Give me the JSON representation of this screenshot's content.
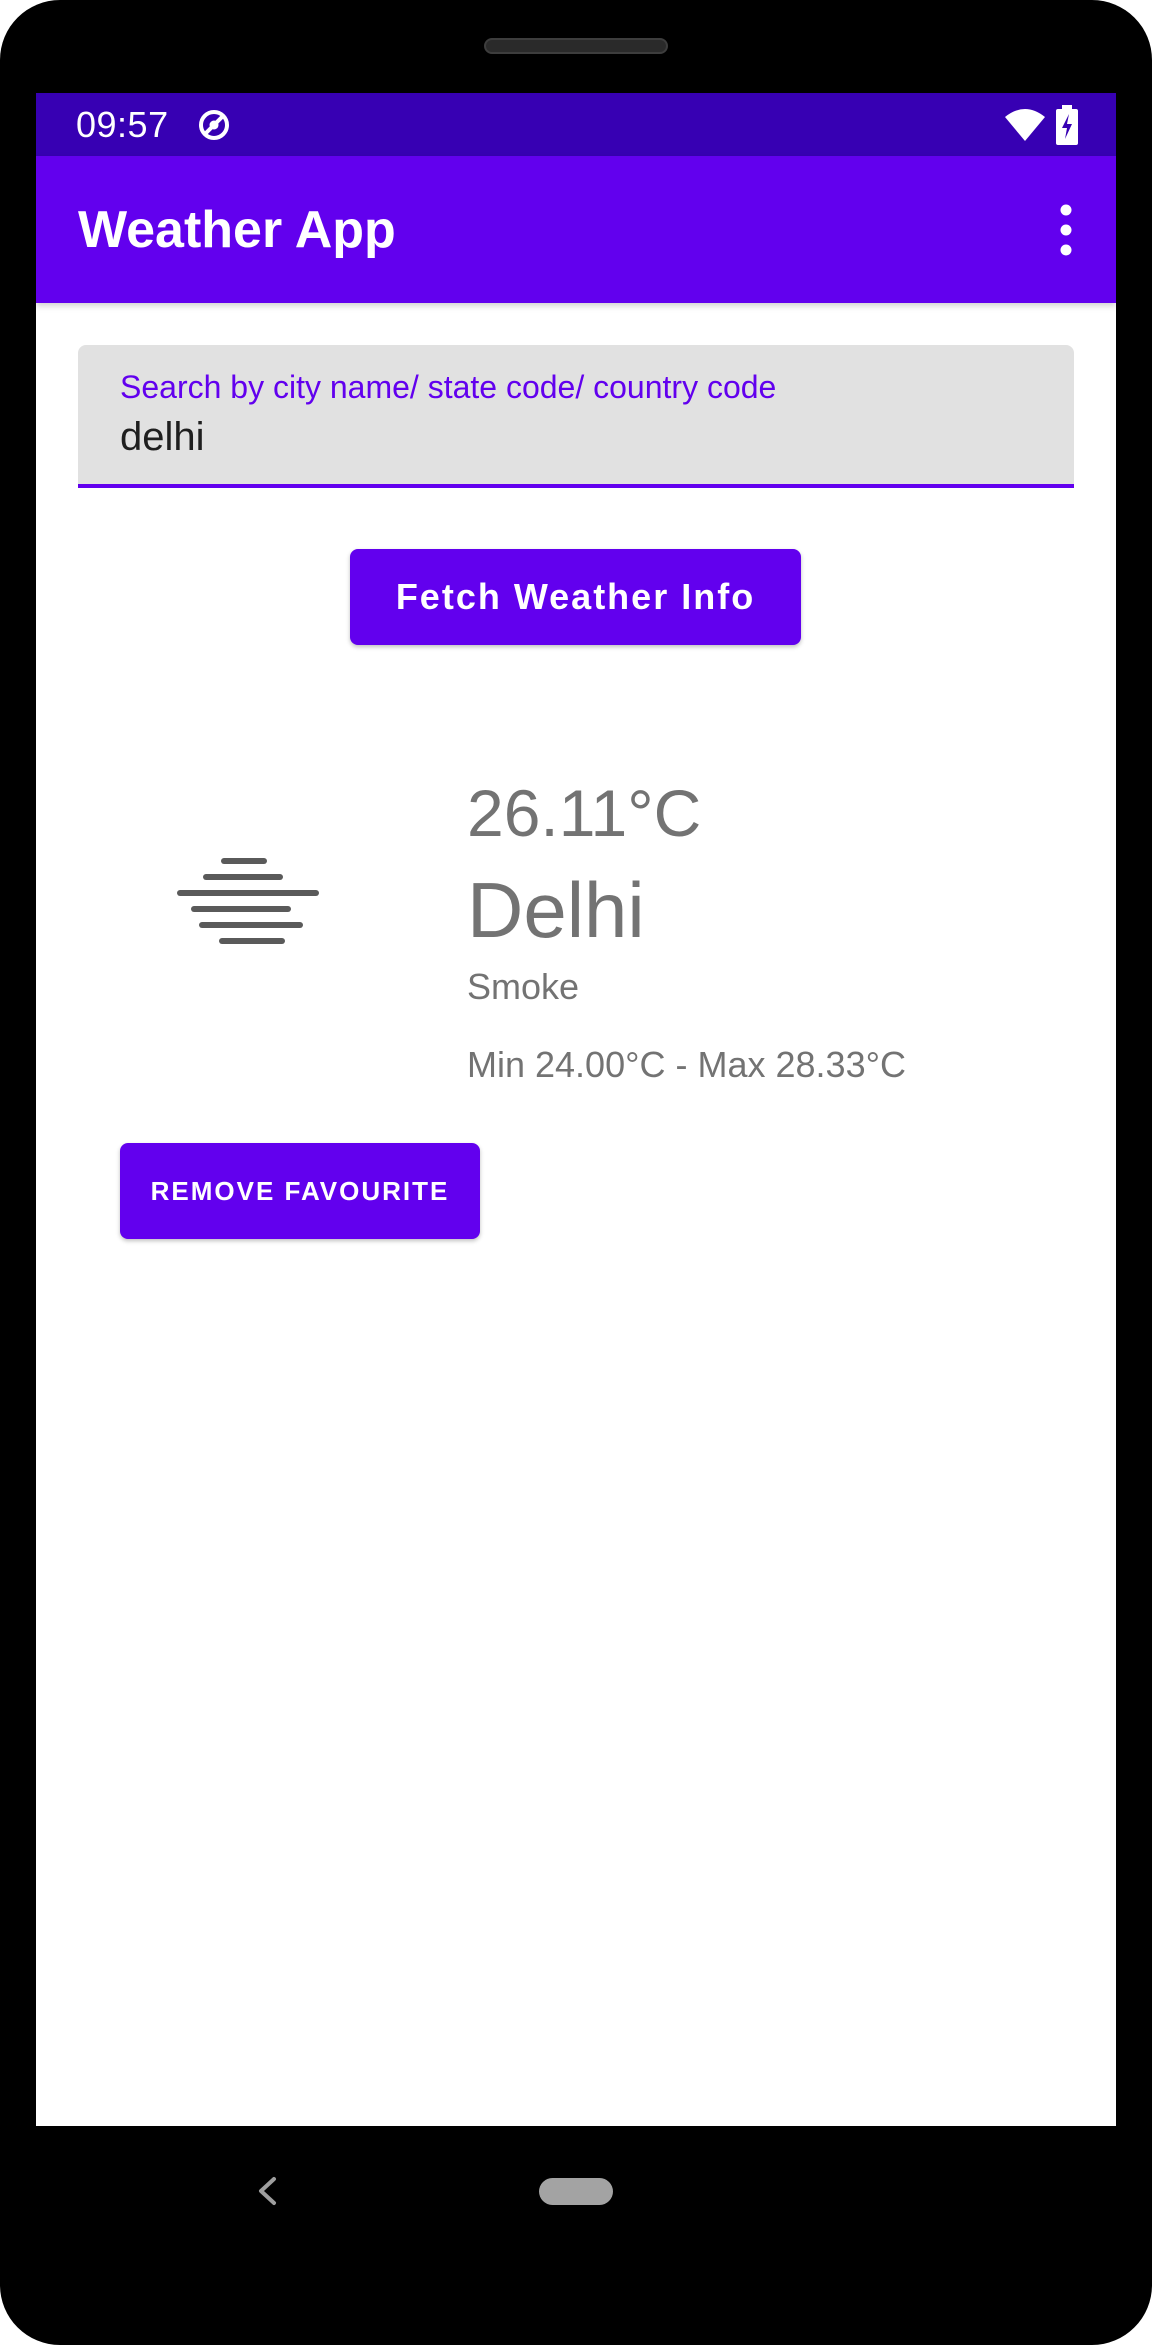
{
  "status_bar": {
    "time": "09:57",
    "icons": [
      "do-not-disturb-icon",
      "wifi-icon",
      "battery-charging-icon"
    ]
  },
  "app_bar": {
    "title": "Weather App",
    "menu_icon": "overflow-menu-icon"
  },
  "search": {
    "label": "Search by city name/ state code/ country code",
    "value": "delhi"
  },
  "fetch_button": {
    "label": "Fetch Weather Info"
  },
  "weather": {
    "icon": "smoke-haze-icon",
    "temperature": "26.11°C",
    "city": "Delhi",
    "condition": "Smoke",
    "min_max": "Min 24.00°C - Max 28.33°C"
  },
  "remove_button": {
    "label": "REMOVE FAVOURITE"
  },
  "nav_bar": {
    "back_icon": "back-chevron-icon",
    "home_icon": "home-pill-icon"
  },
  "colors": {
    "primary": "#6200ee",
    "primary_dark": "#3700b3",
    "text_secondary": "#737373",
    "field_background": "#e1e1e1"
  }
}
